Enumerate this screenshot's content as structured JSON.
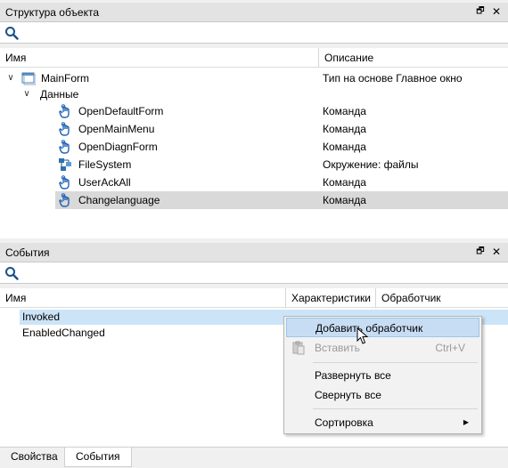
{
  "object_panel": {
    "title": "Структура объекта",
    "restore_glyph": "🗗",
    "close_glyph": "✕",
    "search_placeholder": "",
    "col_name": "Имя",
    "col_desc": "Описание",
    "tree": [
      {
        "name": "MainForm",
        "desc": "Тип на основе Главное окно",
        "icon": "form-icon",
        "level": 0,
        "expanded": true
      },
      {
        "name": "Данные",
        "desc": "",
        "icon": "",
        "level": 1,
        "expanded": true
      },
      {
        "name": "OpenDefaultForm",
        "desc": "Команда",
        "icon": "hand-pointer-icon",
        "level": 2
      },
      {
        "name": "OpenMainMenu",
        "desc": "Команда",
        "icon": "hand-pointer-icon",
        "level": 2
      },
      {
        "name": "OpenDiagnForm",
        "desc": "Команда",
        "icon": "hand-pointer-icon",
        "level": 2
      },
      {
        "name": "FileSystem",
        "desc": "Окружение: файлы",
        "icon": "file-system-icon",
        "level": 2
      },
      {
        "name": "UserAckAll",
        "desc": "Команда",
        "icon": "hand-pointer-icon",
        "level": 2
      },
      {
        "name": "Changelanguage",
        "desc": "Команда",
        "icon": "hand-pointer-icon",
        "level": 2,
        "selected": true
      }
    ]
  },
  "events_panel": {
    "title": "События",
    "restore_glyph": "🗗",
    "close_glyph": "✕",
    "col_name": "Имя",
    "col_chars": "Характеристики",
    "col_handler": "Обработчик",
    "events": [
      {
        "name": "Invoked",
        "selected": true
      },
      {
        "name": "EnabledChanged",
        "selected": false
      }
    ]
  },
  "context_menu": {
    "add_handler": "Добавить обработчик",
    "paste": "Вставить",
    "paste_shortcut": "Ctrl+V",
    "expand_all": "Развернуть все",
    "collapse_all": "Свернуть все",
    "sort": "Сортировка",
    "sort_arrow": "▶"
  },
  "tabs": {
    "properties": "Свойства",
    "events": "События"
  },
  "colors": {
    "selection_gray": "#d9d9d9",
    "selection_blue": "#cce4f7",
    "menu_highlight": "#c7ddf3",
    "hand_icon_blue": "#1f63b5"
  }
}
